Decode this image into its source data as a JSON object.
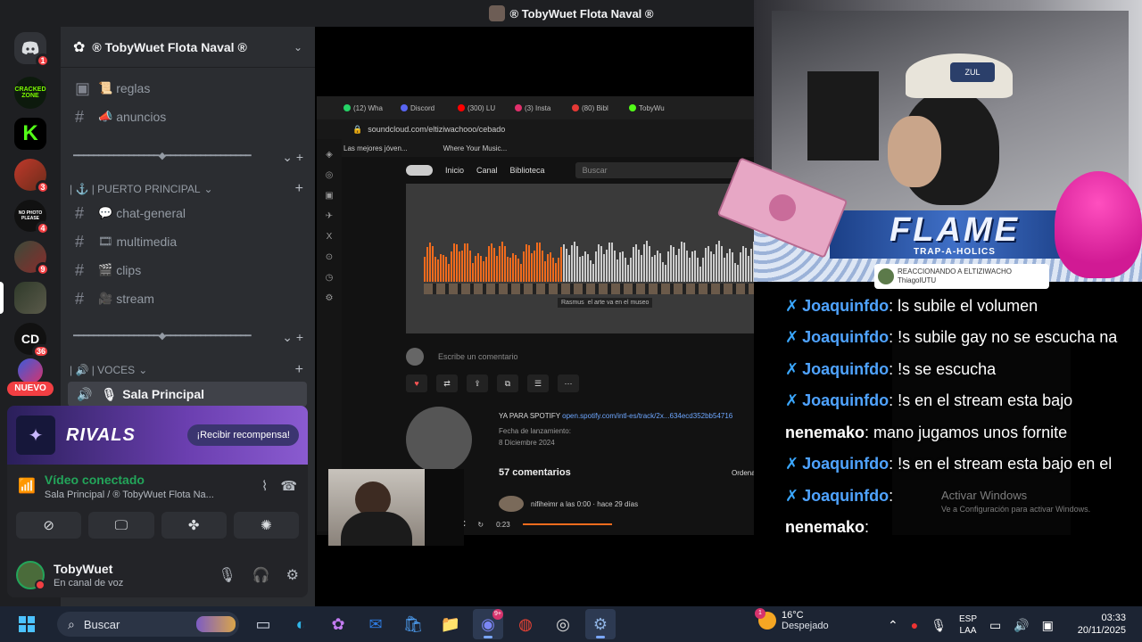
{
  "window": {
    "title": "® TobyWuet Flota Naval ®"
  },
  "servers": [
    {
      "name": "discord-home",
      "badge": "1"
    },
    {
      "name": "cracked-zone",
      "label": "CRACKED ZONE"
    },
    {
      "name": "kick",
      "label": "K"
    },
    {
      "name": "server-3",
      "badge": "3"
    },
    {
      "name": "no-photo",
      "label": "NO PHOTO PLEASE",
      "badge": "4"
    },
    {
      "name": "server-9",
      "badge": "9"
    },
    {
      "name": "server-active"
    },
    {
      "name": "cd",
      "label": "CD",
      "badge": "36"
    },
    {
      "name": "server-nuevo"
    }
  ],
  "nuevo_label": "NUEVO",
  "server_header": {
    "name": "® TobyWuet Flota Naval ®"
  },
  "channels": {
    "reglas": "reglas",
    "anuncios": "anuncios",
    "separator1": "━━━━━━━━━━━━━━━━━◆━━━━━━━━━━━━━━━━━",
    "category_puerto": "| ⚓ | PUERTO PRINCIPAL",
    "chat_general": "chat-general",
    "multimedia": "multimedia",
    "clips": "clips",
    "stream": "stream",
    "separator2": "━━━━━━━━━━━━━━━━━◆━━━━━━━━━━━━━━━━━",
    "category_voces": "| 🔊 | VOCES",
    "sala_principal": "Sala Principal"
  },
  "promo": {
    "title": "RIVALS",
    "button": "¡Recibir recompensa!"
  },
  "voice_status": {
    "title": "Vídeo conectado",
    "subtitle": "Sala Principal / ® TobyWuet Flota Na..."
  },
  "user": {
    "name": "TobyWuet",
    "status": "En canal de voz"
  },
  "browser": {
    "tabs": [
      "(12) Wha",
      "Discord",
      "(300) LU",
      "(3) Insta",
      "(80) Bibl",
      "TobyWu"
    ],
    "url": "soundcloud.com/eltiziwachooo/cebado",
    "bookmarks": [
      "Las mejores jóven...",
      "Where Your Music..."
    ],
    "nav": [
      "Inicio",
      "Canal",
      "Biblioteca"
    ],
    "search_placeholder": "Buscar",
    "waveform_comment_user": "Rasmus",
    "waveform_comment": "el arte va en el museo",
    "comment_placeholder": "Escribe un comentario",
    "track_desc": "YA PARA SPOTIFY",
    "track_link": "open.spotify.com/intl-es/track/2x...634ecd352bb54716",
    "release_label": "Fecha de lanzamiento:",
    "release_date": "8 Diciembre 2024",
    "comments_count": "57 comentarios",
    "sort_label": "Ordenado por: Lo más nuevo",
    "first_comment": "nifiheimr a las 0:00 · hace 29 días",
    "player_time": "0:23"
  },
  "overlay": {
    "banner_title": "FLAME",
    "banner_sub": "TRAP-A-HOLICS",
    "cap_text": "ZUL",
    "react_line1": "REACCIONANDO A ELTIZIWACHO",
    "react_line2": "ThiagoIUTU"
  },
  "chat": [
    {
      "user": "Joaquinfdo",
      "text": ": ls subile el volumen",
      "badge": true,
      "color": "blue"
    },
    {
      "user": "Joaquinfdo",
      "text": ": !s subile gay no se escucha na",
      "badge": true,
      "color": "blue"
    },
    {
      "user": "Joaquinfdo",
      "text": ": !s se escucha",
      "badge": true,
      "color": "blue"
    },
    {
      "user": "Joaquinfdo",
      "text": ": !s en el stream esta bajo",
      "badge": true,
      "color": "blue"
    },
    {
      "user": "nenemako",
      "text": ": mano jugamos unos fornite",
      "badge": false,
      "color": "green"
    },
    {
      "user": "Joaquinfdo",
      "text": ": !s en el stream esta bajo en el",
      "badge": true,
      "color": "blue"
    },
    {
      "user": "Joaquinfdo",
      "text": ":",
      "badge": true,
      "color": "blue"
    },
    {
      "user": "nenemako",
      "text": ":",
      "badge": false,
      "color": "green"
    }
  ],
  "activate_windows": {
    "title": "Activar Windows",
    "subtitle": "Ve a Configuración para activar Windows."
  },
  "taskbar": {
    "search": "Buscar",
    "discord_badge": "9+",
    "weather_temp": "16°C",
    "weather_desc": "Despejado",
    "weather_badge": "1",
    "lang1": "ESP",
    "lang2": "LAA",
    "time": "03:33",
    "date": "20/11/2025"
  },
  "colors": {
    "discord_bg": "#2b2d31",
    "rail_bg": "#1e1f22",
    "green": "#23a55a",
    "soundcloud": "#f26b1d",
    "taskbar": "#1c2433"
  }
}
